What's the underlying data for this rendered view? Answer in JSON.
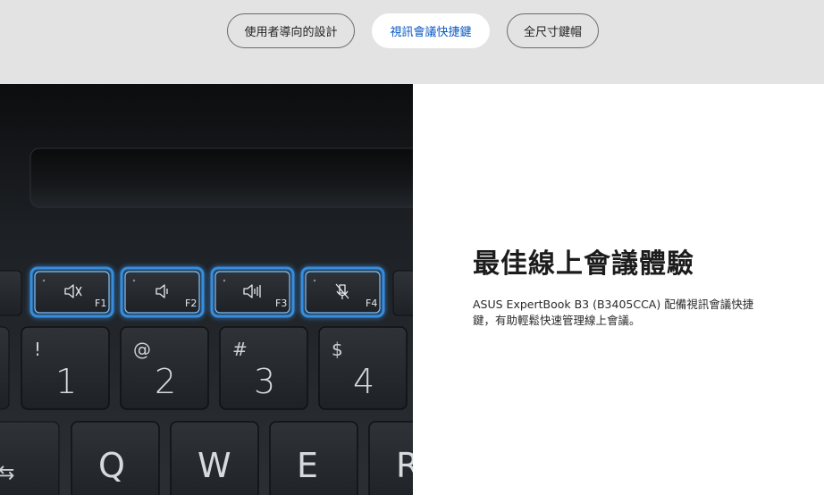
{
  "tabs": [
    {
      "label": "使用者導向的設計",
      "active": false
    },
    {
      "label": "視訊會議快捷鍵",
      "active": true
    },
    {
      "label": "全尺寸鍵帽",
      "active": false
    }
  ],
  "feature": {
    "heading": "最佳線上會議體驗",
    "body": "ASUS ExpertBook B3 (B3405CCA) 配備視訊會議快捷鍵，有助輕鬆快速管理線上會議。"
  },
  "keyboard": {
    "function_keys": [
      {
        "label": "F1",
        "icon": "mute-speaker-icon"
      },
      {
        "label": "F2",
        "icon": "volume-down-icon"
      },
      {
        "label": "F3",
        "icon": "volume-up-icon"
      },
      {
        "label": "F4",
        "icon": "mic-mute-icon"
      }
    ],
    "number_keys": [
      {
        "symbol": "!",
        "digit": "1"
      },
      {
        "symbol": "@",
        "digit": "2"
      },
      {
        "symbol": "#",
        "digit": "3"
      },
      {
        "symbol": "$",
        "digit": "4"
      }
    ],
    "letter_keys": [
      "Q",
      "W",
      "E",
      "R"
    ],
    "tab_glyph": "⇆",
    "accent_color": "#3aa0ff"
  }
}
